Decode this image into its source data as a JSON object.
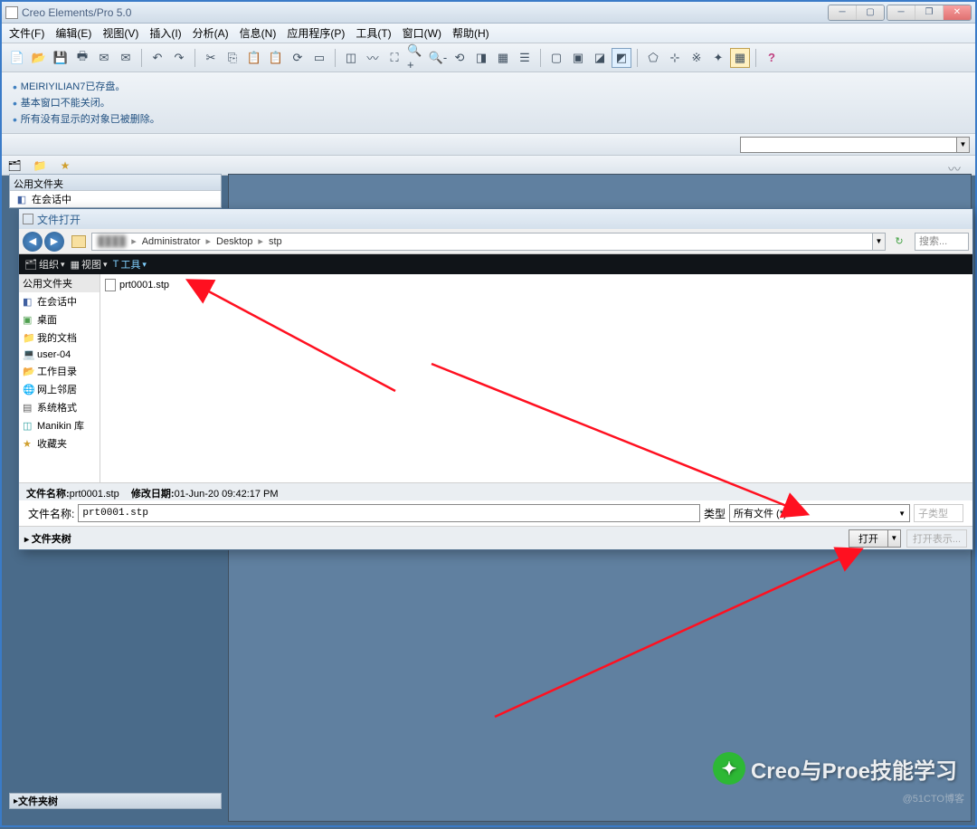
{
  "app_title": "Creo Elements/Pro 5.0",
  "menu": [
    "文件(F)",
    "编辑(E)",
    "视图(V)",
    "插入(I)",
    "分析(A)",
    "信息(N)",
    "应用程序(P)",
    "工具(T)",
    "窗口(W)",
    "帮助(H)"
  ],
  "messages": [
    "MEIRIYILIAN7已存盘。",
    "基本窗口不能关闭。",
    "所有没有显示的对象已被删除。"
  ],
  "sidebar_header": "公用文件夹",
  "sidebar_items": [
    {
      "icon": "◧",
      "label": "在会话中"
    }
  ],
  "footer_tree": "文件夹树",
  "dialog_title": "文件打开",
  "breadcrumb_blur": "████",
  "breadcrumb": [
    "Administrator",
    "Desktop",
    "stp"
  ],
  "search_placeholder": "搜索...",
  "dlg_toolbar": {
    "org": "组织",
    "view": "视图",
    "tools": "工具"
  },
  "dlg_sidebar_hdr": "公用文件夹",
  "dlg_sidebar": [
    {
      "icon": "◧",
      "label": "在会话中",
      "color": "#4060a0"
    },
    {
      "icon": "▣",
      "label": "桌面",
      "color": "#50a050"
    },
    {
      "icon": "📁",
      "label": "我的文档",
      "color": "#c09040"
    },
    {
      "icon": "💻",
      "label": "user-04",
      "color": "#606060"
    },
    {
      "icon": "📂",
      "label": "工作目录",
      "color": "#c09040"
    },
    {
      "icon": "🌐",
      "label": "网上邻居",
      "color": "#4080c0"
    },
    {
      "icon": "▤",
      "label": "系统格式",
      "color": "#606060"
    },
    {
      "icon": "◫",
      "label": "Manikin 库",
      "color": "#30a0a0"
    },
    {
      "icon": "★",
      "label": "收藏夹",
      "color": "#d0a030"
    }
  ],
  "file_list": [
    {
      "name": "prt0001.stp"
    }
  ],
  "file_info": {
    "name_label": "文件名称:",
    "name": "prt0001.stp",
    "date_label": "修改日期:",
    "date": "01-Jun-20 09:42:17 PM"
  },
  "name_label": "文件名称:",
  "name_value": "prt0001.stp",
  "type_label": "类型",
  "type_value": "所有文件 (*)",
  "subtype_label": "子类型",
  "open_label": "打开",
  "open_table_label": "打开表示...",
  "dlg_footer_tree": "文件夹树",
  "watermark": "Creo与Proe技能学习",
  "blog": "@51CTO博客",
  "help_icon": "?"
}
